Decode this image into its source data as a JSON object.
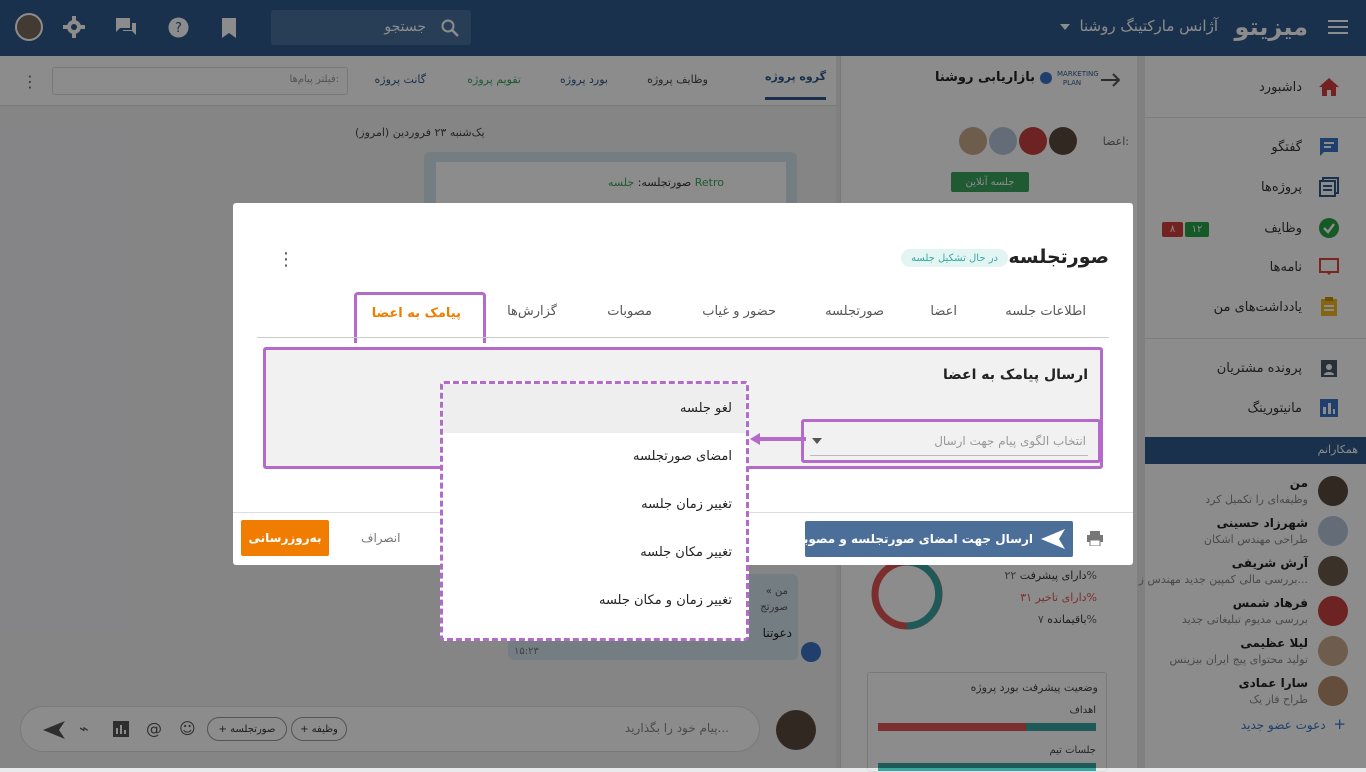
{
  "app": {
    "brand": "میزیتو",
    "org": "آژانس مارکتینگ روشنا"
  },
  "search": {
    "placeholder": "جستجو"
  },
  "sidebar": {
    "items": [
      {
        "label": "داشبورد",
        "icon": "home-icon"
      },
      {
        "label": "گفتگو",
        "icon": "chat-icon"
      },
      {
        "label": "پروژه‌ها",
        "icon": "projects-icon"
      },
      {
        "label": "وظایف",
        "icon": "tasks-icon"
      },
      {
        "label": "نامه‌ها",
        "icon": "letters-icon"
      },
      {
        "label": "یادداشت‌های من",
        "icon": "notes-icon"
      },
      {
        "label": "پرونده مشتریان",
        "icon": "customers-icon"
      },
      {
        "label": "مانیتورینگ",
        "icon": "monitoring-icon"
      }
    ],
    "task_badges": [
      "۱۲",
      "۸"
    ],
    "colleagues_header": "همکارانم",
    "colleagues": [
      {
        "name": "من",
        "role": "وظیفه‌ای را تکمیل کرد"
      },
      {
        "name": "شهرزاد حسینی",
        "role": "طراحی مهندس اشکان"
      },
      {
        "name": "آرش شریفی",
        "role": "بررسی مالی کمپین جدید مهندس ز..."
      },
      {
        "name": "فرهاد شمس",
        "role": "بررسی مدیوم تبلیغاتی جدید"
      },
      {
        "name": "لیلا عظیمی",
        "role": "تولید محتوای پیج ایران بیزینس"
      },
      {
        "name": "سارا عمادی",
        "role": "طراح فاز یک"
      }
    ],
    "invite": "دعوت عضو جدید"
  },
  "project": {
    "title": "بازاریابی روشنا",
    "logo_text": "MARKETING PLAN",
    "members_label": "اعضا:",
    "online_meeting": "جلسه آنلاین",
    "stats": [
      {
        "label": "دارای پیشرفت",
        "value": "۲۲%"
      },
      {
        "label": "دارای تاخیر",
        "value": "۳۱%"
      },
      {
        "label": "باقیمانده",
        "value": "۷%"
      }
    ],
    "board_title": "وضعیت پیشرفت بورد پروژه",
    "bars": [
      {
        "label": "اهداف",
        "left": "۶۸%",
        "right": "۳۲%"
      },
      {
        "label": "جلسات تیم",
        "left": "۶۵%",
        "right": "۳۵%"
      }
    ]
  },
  "chat": {
    "tabs": [
      "گروه پروژه",
      "وظایف پروژه",
      "بورد پروژه",
      "تقویم پروژه",
      "گانت پروژه"
    ],
    "filter_placeholder": "فیلتر پیام‌ها:",
    "date": "یک‌شنبه ۲۳ فروردین (امروز)",
    "minutes_prefix": "صورتجلسه:",
    "minutes_link": "جلسه Retro",
    "quote_author": "« من",
    "quote_text": "صورتج",
    "message": "دعوتنا",
    "time": "۱۵:۲۳",
    "input_placeholder": "پیام خود را بگذارید...",
    "chip_task": "+ وظیفه",
    "chip_minutes": "+ صورتجلسه"
  },
  "modal": {
    "title": "صورتجلسه",
    "status": "در حال تشکیل جلسه",
    "tabs": [
      "اطلاعات جلسه",
      "اعضا",
      "صورتجلسه",
      "حضور و غیاب",
      "مصوبات",
      "گزارش‌ها",
      "پیامک به اعضا"
    ],
    "section_title": "ارسال پیامک به اعضا",
    "select_placeholder": "انتخاب الگوی پیام جهت ارسال",
    "options": [
      "لغو جلسه",
      "امضای صورتجلسه",
      "تغییر زمان جلسه",
      "تغییر مکان جلسه",
      "تغییر زمان و مکان جلسه"
    ],
    "send_button": "ارسال جهت امضای صورتجلسه و مصوبات",
    "cancel_button": "انصراف",
    "update_button": "به‌روزرسانی"
  },
  "colors": {
    "primary": "#2f5a8a",
    "accent": "#b36ac8",
    "orange": "#f07d00",
    "teal": "#37a7a0",
    "green": "#3aa55d",
    "red": "#e05555"
  }
}
